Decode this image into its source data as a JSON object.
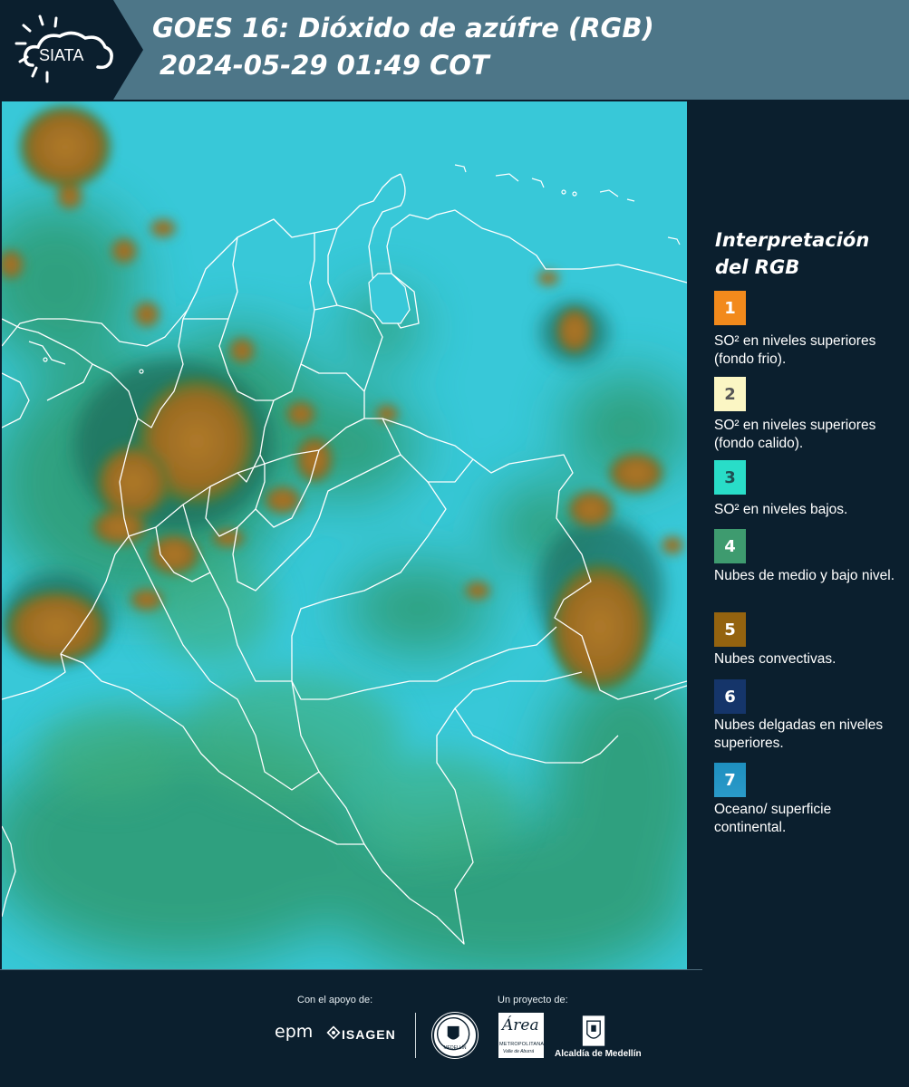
{
  "header": {
    "logo_text": "SIATA",
    "title_line1": "GOES 16: Dióxido de azúfre (RGB)",
    "title_line2": "2024-05-29 01:49 COT"
  },
  "legend": {
    "title": "Interpretación del RGB",
    "items": [
      {
        "number": "1",
        "label": "SO² en niveles superiores (fondo frio).",
        "color": "#f28a1c"
      },
      {
        "number": "2",
        "label": "SO² en niveles superiores (fondo calido).",
        "color": "#fbf6c4"
      },
      {
        "number": "3",
        "label": "SO² en niveles bajos.",
        "color": "#29ddc8"
      },
      {
        "number": "4",
        "label": "Nubes de medio y bajo nivel.",
        "color": "#3e9b6f"
      },
      {
        "number": "5",
        "label": "Nubes convectivas.",
        "color": "#94630f"
      },
      {
        "number": "6",
        "label": "Nubes delgadas en niveles superiores.",
        "color": "#15356a"
      },
      {
        "number": "7",
        "label": "Oceano/ superficie continental.",
        "color": "#1e8fbf"
      }
    ]
  },
  "footer": {
    "support_caption": "Con el apoyo de:",
    "project_caption": "Un proyecto de:",
    "logos": {
      "epm": "epm",
      "isagen": "ISAGEN",
      "medellin_seal": "MEDELLÍN",
      "area_script": "Área",
      "area_name": "METROPOLITANA",
      "area_sub": "Valle de Aburrá",
      "alcaldia": "Alcaldía de Medellín"
    }
  },
  "colors": {
    "background": "#0b1f2e",
    "header_band": "#4d7688",
    "ocean": "#35c6d8",
    "land": "#2e9a72",
    "convective": "#9a6b22",
    "borders": "#ffffff"
  }
}
